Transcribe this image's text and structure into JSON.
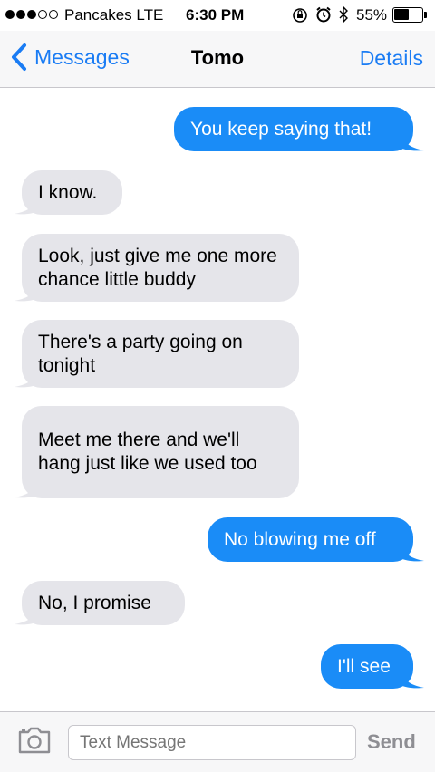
{
  "status_bar": {
    "signal_filled": 3,
    "signal_total": 5,
    "carrier": "Pancakes  LTE",
    "time": "6:30 PM",
    "battery_percent": "55%",
    "battery_level": 0.55,
    "icons": [
      "rotation-lock-icon",
      "alarm-icon",
      "bluetooth-icon"
    ]
  },
  "nav": {
    "back_label": "Messages",
    "title": "Tomo",
    "details_label": "Details"
  },
  "colors": {
    "accent": "#1a7cf4",
    "outgoing_bubble": "#1a8cf7",
    "incoming_bubble": "#e5e5ea"
  },
  "messages": [
    {
      "direction": "out",
      "text": "You keep saying that!"
    },
    {
      "direction": "in",
      "text": "I know."
    },
    {
      "direction": "in",
      "text": "Look, just give me one more chance little buddy"
    },
    {
      "direction": "in",
      "text": "There's a party going on tonight"
    },
    {
      "direction": "in",
      "text": "Meet me there and we'll hang just like we used too"
    },
    {
      "direction": "out",
      "text": "No blowing me off"
    },
    {
      "direction": "in",
      "text": "No, I promise"
    },
    {
      "direction": "out",
      "text": "I'll see"
    }
  ],
  "composer": {
    "placeholder": "Text Message",
    "send_label": "Send"
  }
}
